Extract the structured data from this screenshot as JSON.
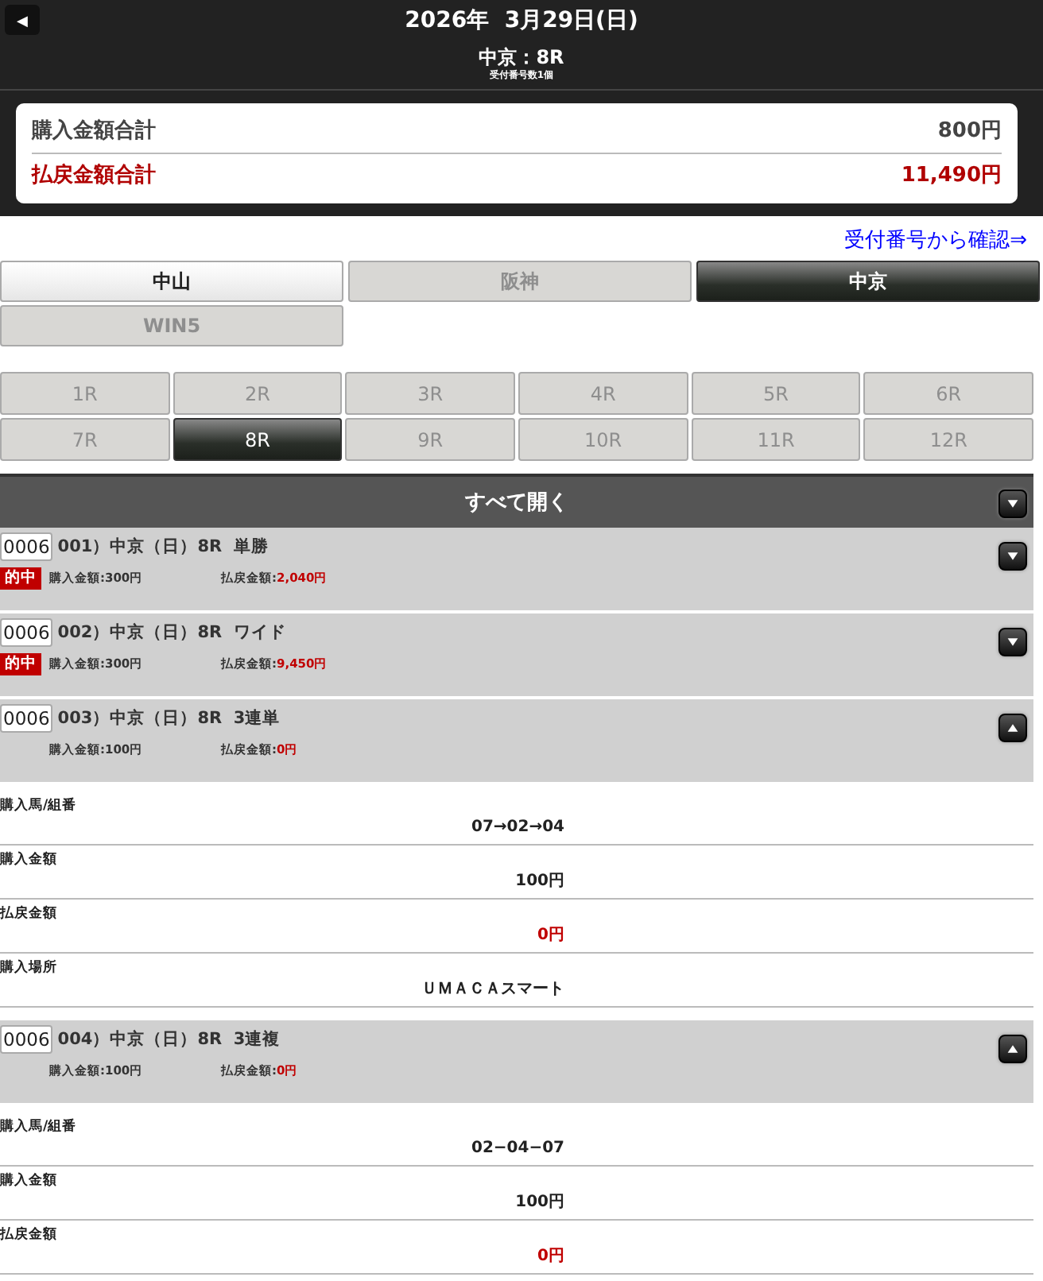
{
  "header": {
    "back_icon_button": "◀",
    "date": "2026年  3月29日(日)",
    "race": "中京：8R",
    "receipt_count": "受付番号数1個"
  },
  "summary": [
    {
      "label": "購入金額合計",
      "value": "800円",
      "kind": "purchase"
    },
    {
      "label": "払戻金額合計",
      "value": "11,490円",
      "kind": "payout"
    }
  ],
  "receipt_link": "受付番号から確認⇒",
  "venue_tabs": [
    {
      "label": "中山",
      "selected": false,
      "disabled": false
    },
    {
      "label": "阪神",
      "selected": false,
      "disabled": true
    },
    {
      "label": "中京",
      "selected": true,
      "disabled": false
    },
    {
      "label": "WIN5",
      "selected": false,
      "disabled": true
    }
  ],
  "race_tabs": [
    {
      "label": "1R",
      "selected": false,
      "disabled": true
    },
    {
      "label": "2R",
      "selected": false,
      "disabled": true
    },
    {
      "label": "3R",
      "selected": false,
      "disabled": true
    },
    {
      "label": "4R",
      "selected": false,
      "disabled": true
    },
    {
      "label": "5R",
      "selected": false,
      "disabled": true
    },
    {
      "label": "6R",
      "selected": false,
      "disabled": true
    },
    {
      "label": "7R",
      "selected": false,
      "disabled": true
    },
    {
      "label": "8R",
      "selected": true,
      "disabled": false
    },
    {
      "label": "9R",
      "selected": false,
      "disabled": true
    },
    {
      "label": "10R",
      "selected": false,
      "disabled": true
    },
    {
      "label": "11R",
      "selected": false,
      "disabled": true
    },
    {
      "label": "12R",
      "selected": false,
      "disabled": true
    }
  ],
  "open_all": {
    "label": "すべて開く",
    "expanded": false
  },
  "tickets": [
    {
      "number": "0006",
      "title": "001）中京（日）8R  単勝",
      "hit": true,
      "hit_label": "的中",
      "purchase": "購入金額:300円",
      "payout_label": "払戻金額:",
      "payout": "2,040円",
      "expanded": false
    },
    {
      "number": "0006",
      "title": "002）中京（日）8R  ワイド",
      "hit": true,
      "hit_label": "的中",
      "purchase": "購入金額:300円",
      "payout_label": "払戻金額:",
      "payout": "9,450円",
      "expanded": false
    },
    {
      "number": "0006",
      "title": "003）中京（日）8R  3連単",
      "hit": false,
      "purchase": "購入金額:100円",
      "payout_label": "払戻金額:",
      "payout": "0円",
      "expanded": true,
      "details": [
        {
          "label": "購入馬/組番",
          "value": "07→02→04",
          "kind": "normal"
        },
        {
          "label": "購入金額",
          "value": "100円",
          "kind": "normal"
        },
        {
          "label": "払戻金額",
          "value": "0円",
          "kind": "payout"
        },
        {
          "label": "購入場所",
          "value": "ＵＭＡＣＡスマート",
          "kind": "normal"
        }
      ]
    },
    {
      "number": "0006",
      "title": "004）中京（日）8R  3連複",
      "hit": false,
      "purchase": "購入金額:100円",
      "payout_label": "払戻金額:",
      "payout": "0円",
      "expanded": true,
      "details": [
        {
          "label": "購入馬/組番",
          "value": "02−04−07",
          "kind": "normal"
        },
        {
          "label": "購入金額",
          "value": "100円",
          "kind": "normal"
        },
        {
          "label": "払戻金額",
          "value": "0円",
          "kind": "payout"
        }
      ]
    }
  ]
}
